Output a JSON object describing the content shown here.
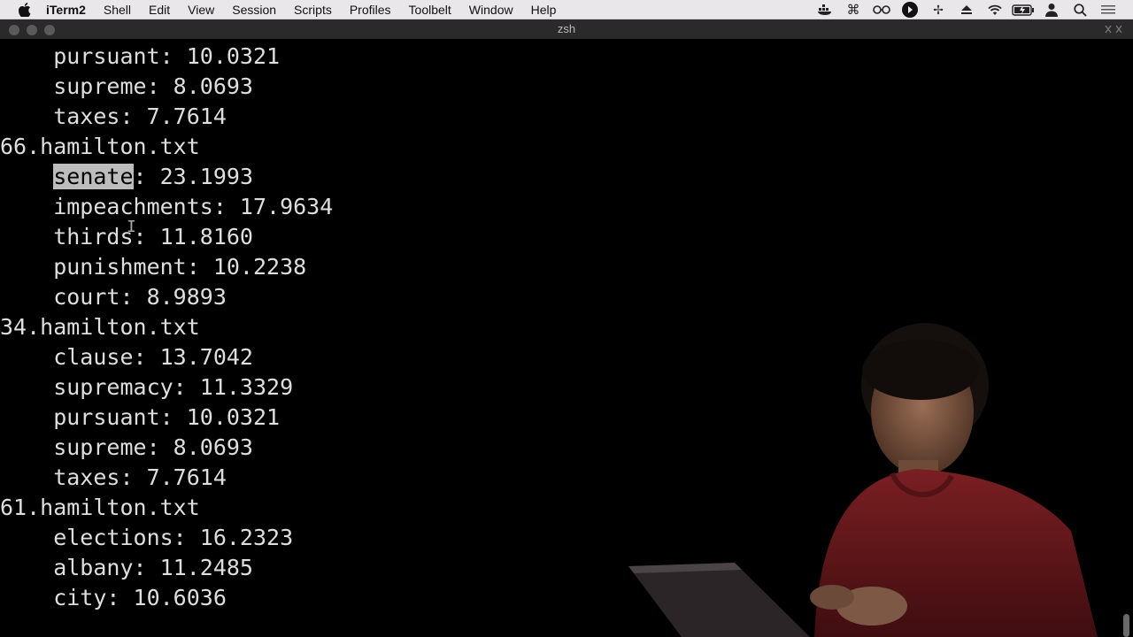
{
  "menubar": {
    "app": "iTerm2",
    "items": [
      "Shell",
      "Edit",
      "View",
      "Session",
      "Scripts",
      "Profiles",
      "Toolbelt",
      "Window",
      "Help"
    ],
    "status_icons": [
      "docker-icon",
      "command-icon",
      "glasses-icon",
      "play-circle-icon",
      "flux-icon",
      "eject-icon",
      "wifi-icon",
      "battery-icon",
      "user-icon",
      "search-icon",
      "list-icon"
    ]
  },
  "window": {
    "title": "zsh"
  },
  "terminal": {
    "lines": [
      "    pursuant: 10.0321",
      "    supreme: 8.0693",
      "    taxes: 7.7614",
      "66.hamilton.txt",
      "    senate: 23.1993",
      "    impeachments: 17.9634",
      "    thirds: 11.8160",
      "    punishment: 10.2238",
      "    court: 8.9893",
      "34.hamilton.txt",
      "    clause: 13.7042",
      "    supremacy: 11.3329",
      "    pursuant: 10.0321",
      "    supreme: 8.0693",
      "    taxes: 7.7614",
      "61.hamilton.txt",
      "    elections: 16.2323",
      "    albany: 11.2485",
      "    city: 10.6036"
    ],
    "highlight": {
      "line": 4,
      "word": "senate"
    }
  }
}
